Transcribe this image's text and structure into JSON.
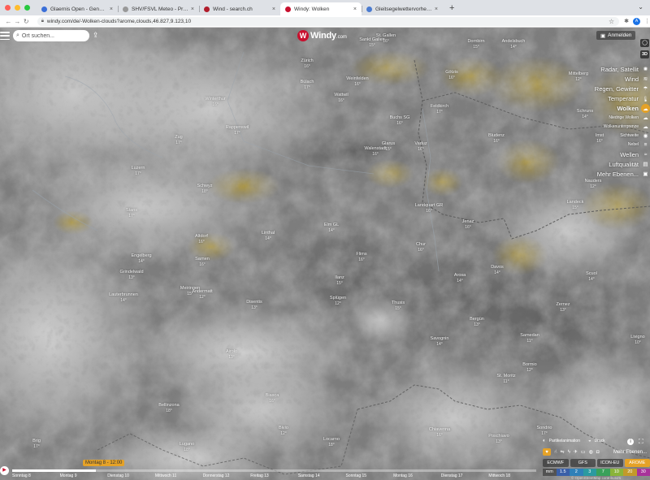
{
  "browser": {
    "tabs": [
      {
        "title": "Glaernis Open - General Briefing",
        "fav": "#3a6fd8",
        "active": false
      },
      {
        "title": "SHV/FSVL Meteo - Previtemp",
        "fav": "#999999",
        "active": false
      },
      {
        "title": "Wind - search.ch",
        "fav": "#b11c2b",
        "active": false
      },
      {
        "title": "Windy: Wolken",
        "fav": "#c8102e",
        "active": true
      },
      {
        "title": "Gleitsegelwettervorhersage | P",
        "fav": "#4a7bd0",
        "active": false
      }
    ],
    "url": "windy.com/de/-Wolken-clouds?arome,clouds,46.827,9.123,10",
    "traffic_colors": [
      "#ff5f57",
      "#febc2e",
      "#28c840"
    ]
  },
  "search": {
    "placeholder": "Ort suchen..."
  },
  "logo": {
    "word": "Windy",
    "domain": ".com"
  },
  "login": {
    "label": "Anmelden"
  },
  "controls": {
    "btn3d": "3D"
  },
  "layers": [
    {
      "label": "Radar, Satellit",
      "icon": "✺",
      "sub": false,
      "active": false
    },
    {
      "label": "Wind",
      "icon": "≋",
      "sub": false,
      "active": false
    },
    {
      "label": "Regen, Gewitter",
      "icon": "☂",
      "sub": false,
      "active": false
    },
    {
      "label": "Temperatur",
      "icon": "🌡",
      "sub": false,
      "active": false
    },
    {
      "label": "Wolken",
      "icon": "☁",
      "sub": false,
      "active": true
    },
    {
      "label": "Niedrige Wolken",
      "icon": "☁",
      "sub": true,
      "active": false
    },
    {
      "label": "Wolkenuntergrenze",
      "icon": "☁",
      "sub": true,
      "active": false
    },
    {
      "label": "Sichtweite",
      "icon": "◉",
      "sub": true,
      "active": false
    },
    {
      "label": "Nebel",
      "icon": "≡",
      "sub": true,
      "active": false
    },
    {
      "label": "Wellen",
      "icon": "≈",
      "sub": false,
      "active": false
    },
    {
      "label": "Luftqualität",
      "icon": "▤",
      "sub": false,
      "active": false
    },
    {
      "label": "Mehr Ebenen...",
      "icon": "▣",
      "sub": false,
      "active": false
    }
  ],
  "bottom": {
    "particles": "Partikelanimation",
    "pressure": "Druck",
    "more_layers": "Mehr Ebenen...",
    "models": [
      {
        "name": "ECMWF",
        "selected": false
      },
      {
        "name": "GFS",
        "selected": false
      },
      {
        "name": "ICON-EU",
        "selected": false
      },
      {
        "name": "AROME",
        "selected": true
      }
    ],
    "legend": [
      {
        "v": "mm",
        "c": "rgba(60,60,60,0.7)"
      },
      {
        "v": "1.5",
        "c": "#3a5fa8"
      },
      {
        "v": "2",
        "c": "#2f80b8"
      },
      {
        "v": "3",
        "c": "#2b9aa0"
      },
      {
        "v": "7",
        "c": "#3aa15a"
      },
      {
        "v": "10",
        "c": "#8ab43a"
      },
      {
        "v": "20",
        "c": "#c39a2a"
      },
      {
        "v": "30",
        "c": "#a8329a"
      }
    ],
    "attribution": "© OpenStreetMap contributors"
  },
  "timeline": {
    "current": "Montag 8 - 12:00",
    "progress": 0.16,
    "days": [
      "Sonntag 8",
      "Montag 9",
      "Dienstag 10",
      "Mittwoch 11",
      "Donnerstag 12",
      "Freitag 13",
      "Samstag 14",
      "Sonntag 15",
      "Montag 16",
      "Dienstag 17",
      "Mittwoch 18"
    ]
  },
  "map_labels": [
    {
      "name": "Zürich",
      "t": "16°"
    },
    {
      "name": "Bülach",
      "t": "17°"
    },
    {
      "name": "Winterthur",
      "t": "16°"
    },
    {
      "name": "Weinfelden",
      "t": "16°"
    },
    {
      "name": "St. Gallen",
      "t": "16°"
    },
    {
      "name": "Sankt Gallen",
      "t": "15°"
    },
    {
      "name": "Dornbirn",
      "t": "15°"
    },
    {
      "name": "Andelsbuch",
      "t": "14°"
    },
    {
      "name": "Mittelberg",
      "t": "12°"
    },
    {
      "name": "Götzis",
      "t": "16°"
    },
    {
      "name": "Feldkirch",
      "t": "17°"
    },
    {
      "name": "Bludenz",
      "t": "16°"
    },
    {
      "name": "Schruns",
      "t": "14°"
    },
    {
      "name": "Rappenswil",
      "t": "17°"
    },
    {
      "name": "Glarus",
      "t": "15°"
    },
    {
      "name": "Wattwil",
      "t": "16°"
    },
    {
      "name": "Buchs SG",
      "t": "16°"
    },
    {
      "name": "Walenstadt",
      "t": "16°"
    },
    {
      "name": "Vaduz",
      "t": "16°"
    },
    {
      "name": "Schwyz",
      "t": "18°"
    },
    {
      "name": "Zug",
      "t": "17°"
    },
    {
      "name": "Luzern",
      "t": "17°"
    },
    {
      "name": "Stans",
      "t": "17°"
    },
    {
      "name": "Altdorf",
      "t": "16°"
    },
    {
      "name": "Linthal",
      "t": "14°"
    },
    {
      "name": "Elm GL",
      "t": "14°"
    },
    {
      "name": "Landquart GR",
      "t": "16°"
    },
    {
      "name": "Chur",
      "t": "16°"
    },
    {
      "name": "Jenaz",
      "t": "16°"
    },
    {
      "name": "Davos",
      "t": "14°"
    },
    {
      "name": "Arosa",
      "t": "14°"
    },
    {
      "name": "Thusis",
      "t": "15°"
    },
    {
      "name": "Flims",
      "t": "16°"
    },
    {
      "name": "Ilanz",
      "t": "15°"
    },
    {
      "name": "Disentis",
      "t": "13°"
    },
    {
      "name": "Andermatt",
      "t": "12°"
    },
    {
      "name": "Engelberg",
      "t": "14°"
    },
    {
      "name": "Sarnen",
      "t": "16°"
    },
    {
      "name": "Meiringen",
      "t": "15°"
    },
    {
      "name": "Splügen",
      "t": "12°"
    },
    {
      "name": "Zernez",
      "t": "13°"
    },
    {
      "name": "Scuol",
      "t": "14°"
    },
    {
      "name": "St. Moritz",
      "t": "11°"
    },
    {
      "name": "Samedan",
      "t": "11°"
    },
    {
      "name": "Poschiavo",
      "t": "13°"
    },
    {
      "name": "Bergün",
      "t": "13°"
    },
    {
      "name": "Savognin",
      "t": "14°"
    },
    {
      "name": "Bivio",
      "t": "12°"
    },
    {
      "name": "Airolo",
      "t": "13°"
    },
    {
      "name": "Biasca",
      "t": "16°"
    },
    {
      "name": "Bellinzona",
      "t": "18°"
    },
    {
      "name": "Locarno",
      "t": "18°"
    },
    {
      "name": "Lugano",
      "t": "18°"
    },
    {
      "name": "Chiavenna",
      "t": "16°"
    },
    {
      "name": "Sondrio",
      "t": "17°"
    },
    {
      "name": "Bormio",
      "t": "12°"
    },
    {
      "name": "Livigno",
      "t": "10°"
    },
    {
      "name": "Landeck",
      "t": "15°"
    },
    {
      "name": "Imst",
      "t": "16°"
    },
    {
      "name": "Nauders",
      "t": "12°"
    },
    {
      "name": "Lauterbrunnen",
      "t": "14°"
    },
    {
      "name": "Grindelwald",
      "t": "13°"
    },
    {
      "name": "Brig",
      "t": "17°"
    }
  ]
}
